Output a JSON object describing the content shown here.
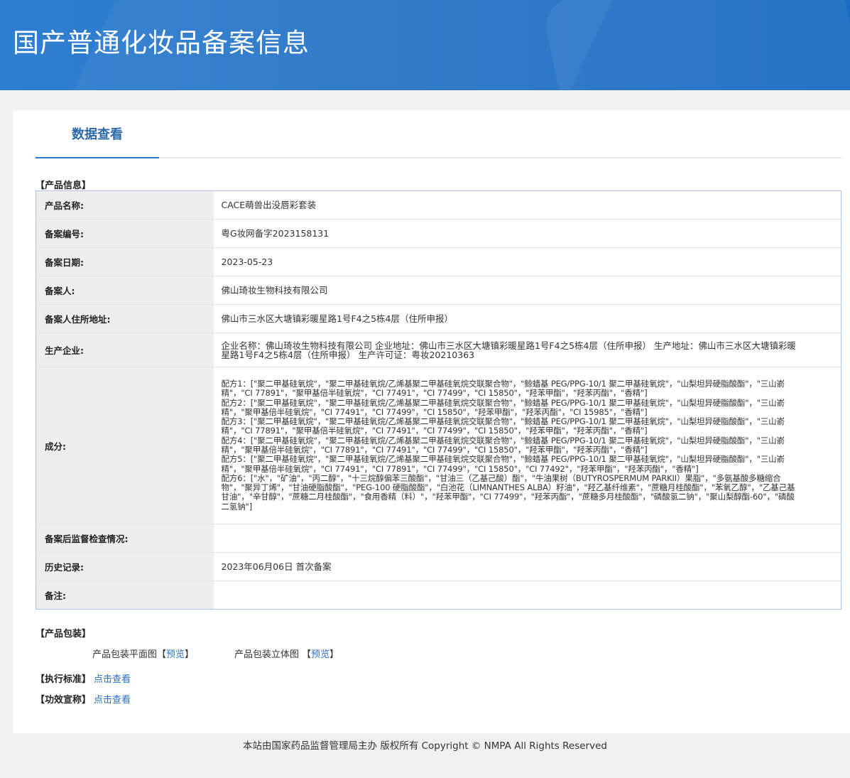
{
  "header": {
    "title": "国产普通化妆品备案信息"
  },
  "tabs": [
    {
      "label": "数据查看"
    }
  ],
  "product_info": {
    "section_label": "【产品信息】",
    "rows": [
      {
        "key": "产品名称:",
        "value": "CACE萌兽出没唇彩套装"
      },
      {
        "key": "备案编号:",
        "value": "粤G妆网备字2023158131"
      },
      {
        "key": "备案日期:",
        "value": "2023-05-23"
      },
      {
        "key": "备案人:",
        "value": "佛山琦妆生物科技有限公司"
      },
      {
        "key": "备案人住所地址:",
        "value": "佛山市三水区大塘镇彩暖星路1号F4之5栋4层（住所申报）"
      },
      {
        "key": "生产企业:",
        "value": "企业名称：佛山琦妆生物科技有限公司 企业地址：佛山市三水区大塘镇彩暖星路1号F4之5栋4层（住所申报） 生产地址：佛山市三水区大塘镇彩暖星路1号F4之5栋4层（住所申报） 生产许可证：粤妆20210363"
      },
      {
        "key": "成分:",
        "formulas": [
          "配方1：[\"聚二甲基硅氧烷\"，\"聚二甲基硅氧烷/乙烯基聚二甲基硅氧烷交联聚合物\"，\"鲸蜡基 PEG/PPG-10/1 聚二甲基硅氧烷\"，\"山梨坦异硬脂酸酯\"，\"三山嵛精\"，\"CI 77891\"，\"聚甲基倍半硅氧烷\"，\"CI 77491\"，\"CI 77499\"，\"CI 15850\"，\"羟苯甲酯\"，\"羟苯丙酯\"，\"香精\"]",
          "配方2：[\"聚二甲基硅氧烷\"，\"聚二甲基硅氧烷/乙烯基聚二甲基硅氧烷交联聚合物\"，\"鲸蜡基 PEG/PPG-10/1 聚二甲基硅氧烷\"，\"山梨坦异硬脂酸酯\"，\"三山嵛精\"，\"聚甲基倍半硅氧烷\"，\"CI 77491\"，\"CI 77499\"，\"CI 15850\"，\"羟苯甲酯\"，\"羟苯丙酯\"，\"CI 15985\"，\"香精\"]",
          "配方3：[\"聚二甲基硅氧烷\"，\"聚二甲基硅氧烷/乙烯基聚二甲基硅氧烷交联聚合物\"，\"鲸蜡基 PEG/PPG-10/1 聚二甲基硅氧烷\"，\"山梨坦异硬脂酸酯\"，\"三山嵛精\"，\"CI 77891\"，\"聚甲基倍半硅氧烷\"，\"CI 77491\"，\"CI 77499\"，\"CI 15850\"，\"羟苯甲酯\"，\"羟苯丙酯\"，\"香精\"]",
          "配方4：[\"聚二甲基硅氧烷\"，\"聚二甲基硅氧烷/乙烯基聚二甲基硅氧烷交联聚合物\"，\"鲸蜡基 PEG/PPG-10/1 聚二甲基硅氧烷\"，\"山梨坦异硬脂酸酯\"，\"三山嵛精\"，\"聚甲基倍半硅氧烷\"，\"CI 77891\"，\"CI 77491\"，\"CI 77499\"，\"CI 15850\"，\"羟苯甲酯\"，\"羟苯丙酯\"，\"香精\"]",
          "配方5：[\"聚二甲基硅氧烷\"，\"聚二甲基硅氧烷/乙烯基聚二甲基硅氧烷交联聚合物\"，\"鲸蜡基 PEG/PPG-10/1 聚二甲基硅氧烷\"，\"山梨坦异硬脂酸酯\"，\"三山嵛精\"，\"聚甲基倍半硅氧烷\"，\"CI 77491\"，\"CI 77891\"，\"CI 77499\"，\"CI 15850\"，\"CI 77492\"，\"羟苯甲酯\"，\"羟苯丙酯\"，\"香精\"]",
          "配方6：[\"水\"，\"矿油\"，\"丙二醇\"，\"十三烷醇偏苯三酸酯\"，\"甘油三（乙基己酸）酯\"，\"牛油果树（BUTYROSPERMUM PARKII）果脂\"，\"多氨基酸多糖缩合物\"，\"聚异丁烯\"，\"甘油硬脂酸酯\"，\"PEG-100 硬脂酸酯\"，\"白池花（LIMNANTHES ALBA）籽油\"，\"羟乙基纤维素\"，\"蔗糖月桂酸酯\"，\"苯氧乙醇\"，\"乙基己基甘油\"，\"辛甘醇\"，\"蔗糖二月桂酸酯\"，\"食用香精（料）\"，\"羟苯甲酯\"，\"CI 77499\"，\"羟苯丙酯\"，\"蔗糖多月桂酸酯\"，\"磷酸氢二钠\"，\"聚山梨醇酯-60\"，\"磷酸二氢钠\"]"
        ]
      },
      {
        "key": "备案后监督检查情况:",
        "value": ""
      },
      {
        "key": "历史记录:",
        "value": "2023年06月06日 首次备案"
      },
      {
        "key": "备注:",
        "value": ""
      }
    ]
  },
  "packaging": {
    "section_label": "【产品包装】",
    "flat_label": "产品包装平面图",
    "flat_link": "预览",
    "solid_label": "产品包装立体图",
    "solid_link": "预览",
    "bracket_open": "【",
    "bracket_close": "】"
  },
  "standard": {
    "label": "【执行标准】",
    "link": "点击查看"
  },
  "efficacy": {
    "label": "【功效宣称】",
    "link": "点击查看"
  },
  "footer": {
    "text": "本站由国家药品监督管理局主办 版权所有 Copyright © NMPA All Rights Reserved"
  }
}
